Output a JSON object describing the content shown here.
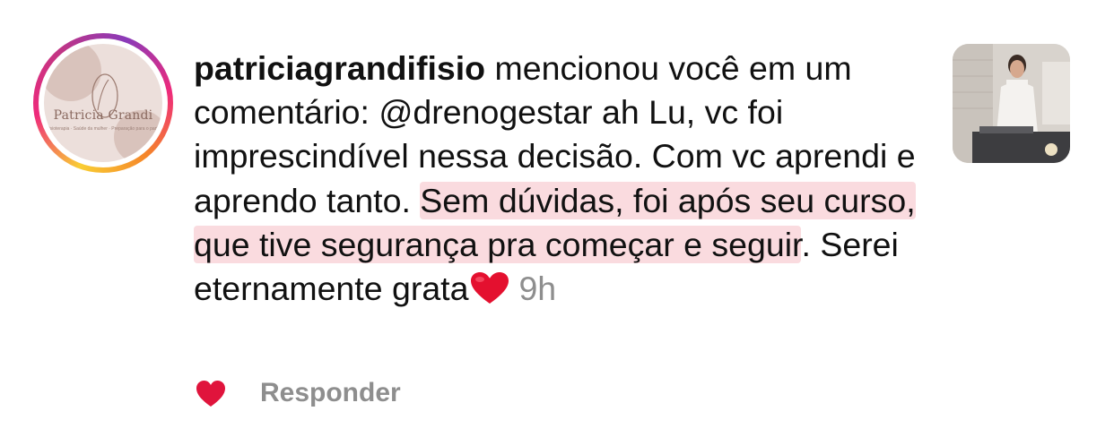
{
  "notification": {
    "username": "patriciagrandifisio",
    "message_parts": [
      " mencionou você em um comentário: @drenogestar ah Lu, vc foi imprescindível nessa decisão. Com vc aprendi e aprendo tanto. ",
      "Sem dúvidas, foi após seu curso,",
      " ",
      "que tive segurança pra começar e seguir",
      ".  Serei eternamente grata"
    ],
    "timestamp": "9h",
    "reply_label": "Responder"
  },
  "avatar": {
    "name": "Patricia Grandi",
    "tagline": "Fisioterapia · Saúde da mulher · Preparação para o parto"
  },
  "icons": {
    "emoji": "red-heart-emoji",
    "like": "heart-icon",
    "story_ring": "gradient-ring"
  },
  "colors": {
    "highlight": "#f6bec4",
    "like_heart": "#e0143c",
    "muted_text": "#8e8e8e"
  }
}
